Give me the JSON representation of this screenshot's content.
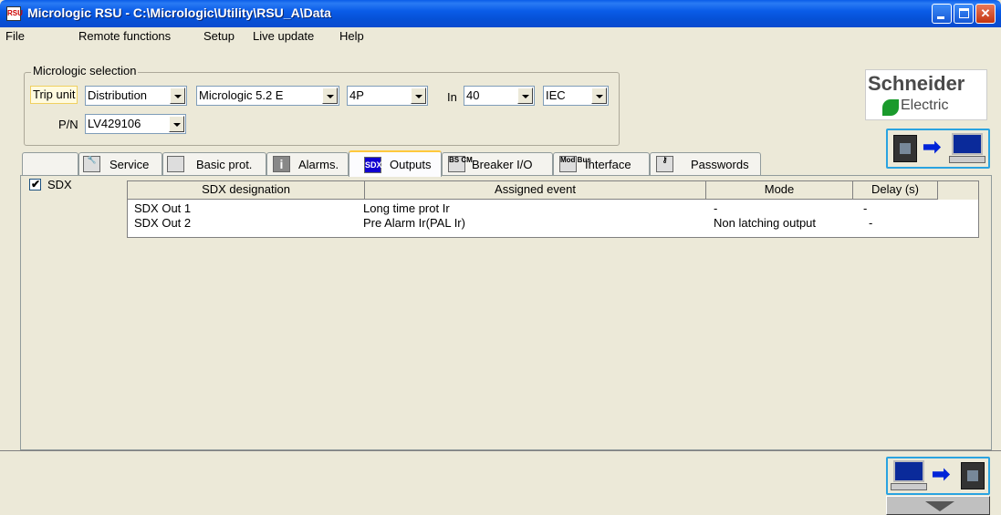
{
  "window": {
    "title": "Micrologic RSU - C:\\Micrologic\\Utility\\RSU_A\\Data",
    "app_icon_text": "RSU"
  },
  "menu": [
    "File",
    "Remote functions",
    "Setup",
    "Live update",
    "Help"
  ],
  "selection": {
    "group_label": "Micrologic selection",
    "trip_unit_label": "Trip unit",
    "trip_unit_value": "Distribution",
    "model_value": "Micrologic 5.2 E",
    "poles_value": "4P",
    "in_label": "In",
    "in_value": "40",
    "standard_value": "IEC",
    "pn_label": "P/N",
    "pn_value": "LV429106"
  },
  "logo": {
    "line1": "Schneider",
    "line2": "Electric"
  },
  "tabs": [
    {
      "label": "Service",
      "icon": "wrench-icon"
    },
    {
      "label": "Basic prot.",
      "icon": "curve-icon"
    },
    {
      "label": "Alarms.",
      "icon": "info-icon",
      "icon_text": "i"
    },
    {
      "label": "Outputs",
      "icon": "sdx-icon",
      "icon_text": "SDX"
    },
    {
      "label": "Breaker I/O",
      "icon": "bscm-icon",
      "icon_text": "BS CM"
    },
    {
      "label": "Interface",
      "icon": "modbus-icon",
      "icon_text": "Mod Bus"
    },
    {
      "label": "Passwords",
      "icon": "key-icon"
    }
  ],
  "active_tab": "Outputs",
  "sdx_checkbox": {
    "label": "SDX",
    "checked": true
  },
  "grid": {
    "columns": [
      "SDX designation",
      "Assigned event",
      "Mode",
      "Delay (s)"
    ],
    "rows": [
      [
        "SDX Out 1",
        "Long time prot Ir",
        "-",
        "-"
      ],
      [
        "SDX Out 2",
        "Pre Alarm Ir(PAL Ir)",
        "Non latching output",
        "-"
      ]
    ]
  }
}
